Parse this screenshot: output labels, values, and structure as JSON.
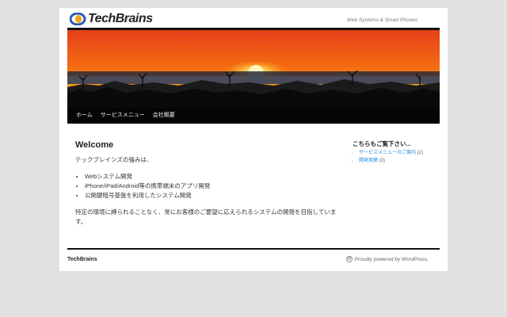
{
  "header": {
    "logo_text": "TechBrains",
    "tagline": "Web Systems & Smart Phones"
  },
  "nav": {
    "items": [
      {
        "label": "ホーム"
      },
      {
        "label": "サービスメニュー"
      },
      {
        "label": "会社概要"
      }
    ]
  },
  "main": {
    "title": "Welcome",
    "intro": "テックブレインズの強みは、",
    "list": [
      "Webシステム開発",
      "iPhone/iPad/Android等の携帯端末のアプリ開発",
      "公開鍵暗号基盤を利用したシステム開発"
    ],
    "closing": "特定の環境に縛られることなく、常にお客様のご要望に応えられるシステムの開発を目指しています。"
  },
  "sidebar": {
    "heading": "こちらもご覧下さい...",
    "links": [
      {
        "label": "サービスメニューのご案内",
        "count": "(2)"
      },
      {
        "label": "開発実績",
        "count": "(3)"
      }
    ]
  },
  "footer": {
    "brand": "TechBrains",
    "powered": "Proudly powered by WordPress."
  },
  "colors": {
    "nav_bg": "#050505",
    "link": "#1b8be0",
    "logo_blue": "#2a5db0",
    "logo_orange": "#f2a516"
  },
  "icons": {
    "logo_mark": "logo-swoosh-icon",
    "wordpress": "wordpress-icon"
  }
}
